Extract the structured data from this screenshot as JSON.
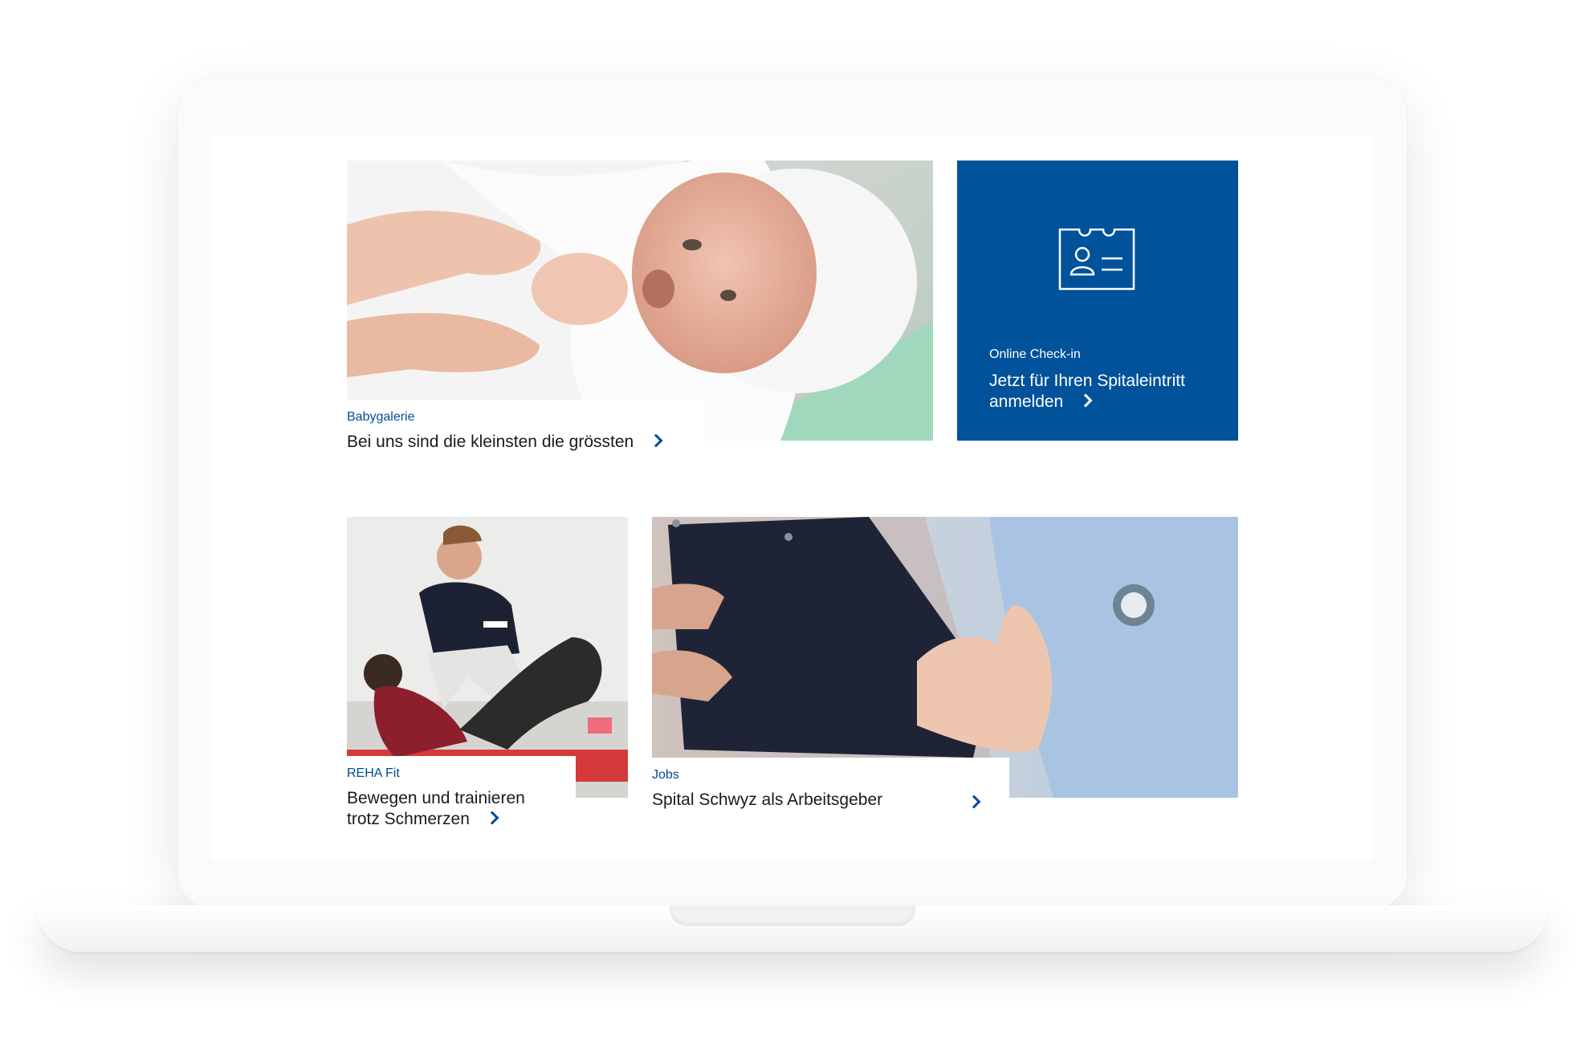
{
  "tiles": {
    "baby": {
      "kicker": "Babygalerie",
      "headline": "Bei uns sind die kleinsten die grössten"
    },
    "checkin": {
      "kicker": "Online Check-in",
      "headline": "Jetzt für Ihren Spitaleintritt anmelden"
    },
    "reha": {
      "kicker": "REHA Fit",
      "headline": "Bewegen und trainieren trotz Schmerzen"
    },
    "jobs": {
      "kicker": "Jobs",
      "headline": "Spital Schwyz als Arbeitsgeber"
    }
  },
  "icons": {
    "checkin": "id-card-icon",
    "arrow": "chevron-right-icon"
  },
  "colors": {
    "brand_blue": "#00529b",
    "link_blue": "#004a99"
  }
}
